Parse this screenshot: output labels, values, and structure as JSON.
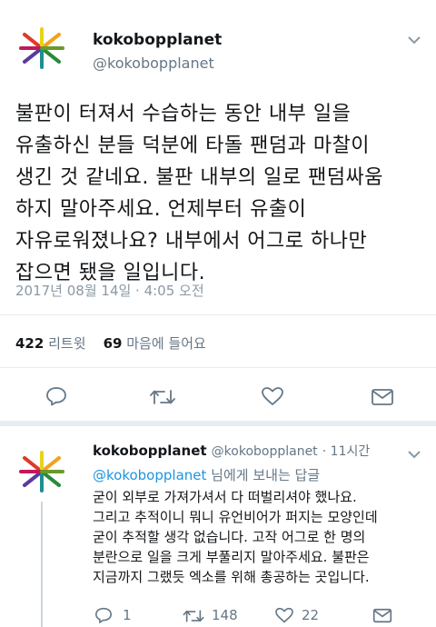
{
  "main_tweet": {
    "name": "kokobopplanet",
    "handle": "@kokobopplanet",
    "text": "불판이 터져서 수습하는 동안 내부 일을\n유출하신 분들 덕분에 타돌 팬덤과 마찰이\n생긴 것 같네요. 불판 내부의 일로 팬덤싸움\n하지 말아주세요. 언제부터 유출이\n자유로워졌나요? 내부에서 어그로 하나만\n잡으면 됐을 일입니다.",
    "timestamp": "2017년 08월 14일 · 4:05 오전",
    "retweets": "422",
    "retweets_label": "리트윗",
    "likes": "69",
    "likes_label": "마음에 들어요"
  },
  "reply_tweet": {
    "name": "kokobopplanet",
    "handle": "@kokobopplanet",
    "time": "· 11시간",
    "mention": "@kokobopplanet",
    "reply_suffix": "님에게 보내는 답글",
    "text": "굳이 외부로 가져가셔서 다 떠벌리셔야 했나요.\n그리고 추적이니 뭐니 유언비어가 퍼지는 모양인데\n굳이 추적할 생각 없습니다. 고작 어그로 한 명의\n분란으로 일을 크게 부풀리지 말아주세요. 불판은\n지금까지 그랬듯 엑소를 위해 총공하는 곳입니다.",
    "reply_count": "1",
    "retweet_count": "148",
    "like_count": "22"
  },
  "colors": {
    "accent": "#1da1f2",
    "muted": "#657786",
    "icon": "#657786"
  }
}
